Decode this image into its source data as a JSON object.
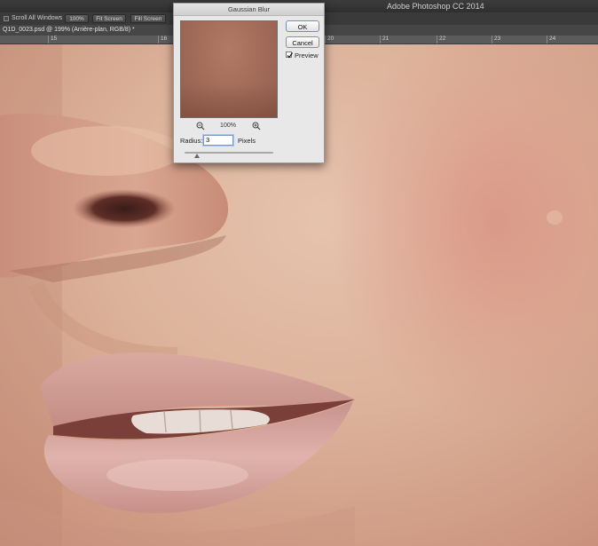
{
  "app_title": "Adobe Photoshop CC 2014",
  "options_bar": {
    "scroll_all_windows_label": "Scroll All Windows",
    "scroll_all_windows_checked": false,
    "buttons": [
      "100%",
      "Fit Screen",
      "Fill Screen"
    ]
  },
  "document_tab": {
    "title": "Q1D_0023.psd @ 199% (Arrière-plan, RGB/8) *"
  },
  "ruler": {
    "labels": [
      "15",
      "16",
      "20",
      "21",
      "22",
      "23",
      "24"
    ]
  },
  "dialog": {
    "title": "Gaussian Blur",
    "ok_label": "OK",
    "cancel_label": "Cancel",
    "preview_label": "Preview",
    "preview_checked": true,
    "zoom_level": "100%",
    "zoom_out_icon": "zoom-out-icon",
    "zoom_in_icon": "zoom-in-icon",
    "radius_label": "Radius:",
    "radius_value": "3",
    "radius_unit": "Pixels"
  },
  "colors": {
    "skin": "#d9ac92",
    "lips": "#c99088",
    "dialog_bg": "#e8e8e8"
  }
}
